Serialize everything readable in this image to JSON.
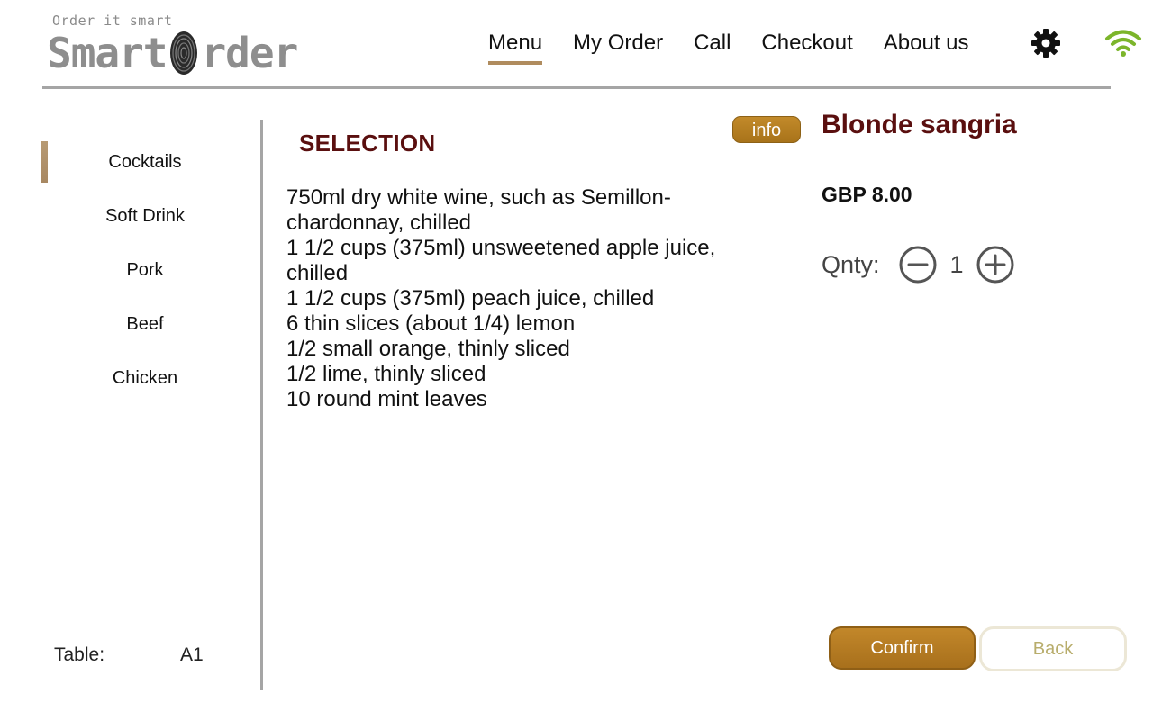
{
  "header": {
    "logo_tagline": "Order it smart",
    "logo_word_1": "Smart",
    "logo_word_2": "rder",
    "nav": [
      {
        "label": "Menu",
        "active": true
      },
      {
        "label": "My Order",
        "active": false
      },
      {
        "label": "Call",
        "active": false
      },
      {
        "label": "Checkout",
        "active": false
      },
      {
        "label": "About us",
        "active": false
      }
    ],
    "icons": {
      "settings": "gear-icon",
      "wifi": "wifi-icon"
    },
    "wifi_color": "#7cb52b"
  },
  "sidebar": {
    "categories": [
      {
        "label": "Cocktails",
        "active": true
      },
      {
        "label": "Soft Drink",
        "active": false
      },
      {
        "label": "Pork",
        "active": false
      },
      {
        "label": "Beef",
        "active": false
      },
      {
        "label": "Chicken",
        "active": false
      }
    ],
    "table_label": "Table:",
    "table_value": "A1"
  },
  "main": {
    "section_title": "SELECTION",
    "info_label": "info",
    "ingredients": [
      "750ml dry white wine, such as Semillon-chardonnay, chilled",
      "1 1/2 cups (375ml) unsweetened apple juice, chilled",
      "1 1/2 cups (375ml) peach juice, chilled",
      "6 thin slices (about 1/4) lemon",
      "1/2 small orange, thinly sliced",
      "1/2 lime, thinly sliced",
      "10 round mint leaves"
    ]
  },
  "product": {
    "name": "Blonde sangria",
    "price": "GBP 8.00",
    "qty_label": "Qnty:",
    "qty_value": "1",
    "confirm_label": "Confirm",
    "back_label": "Back"
  },
  "colors": {
    "accent_brown": "#b08c5e",
    "title_maroon": "#5a0f0f",
    "button_gold": "#b47c22",
    "back_text": "#b8ad6c"
  }
}
